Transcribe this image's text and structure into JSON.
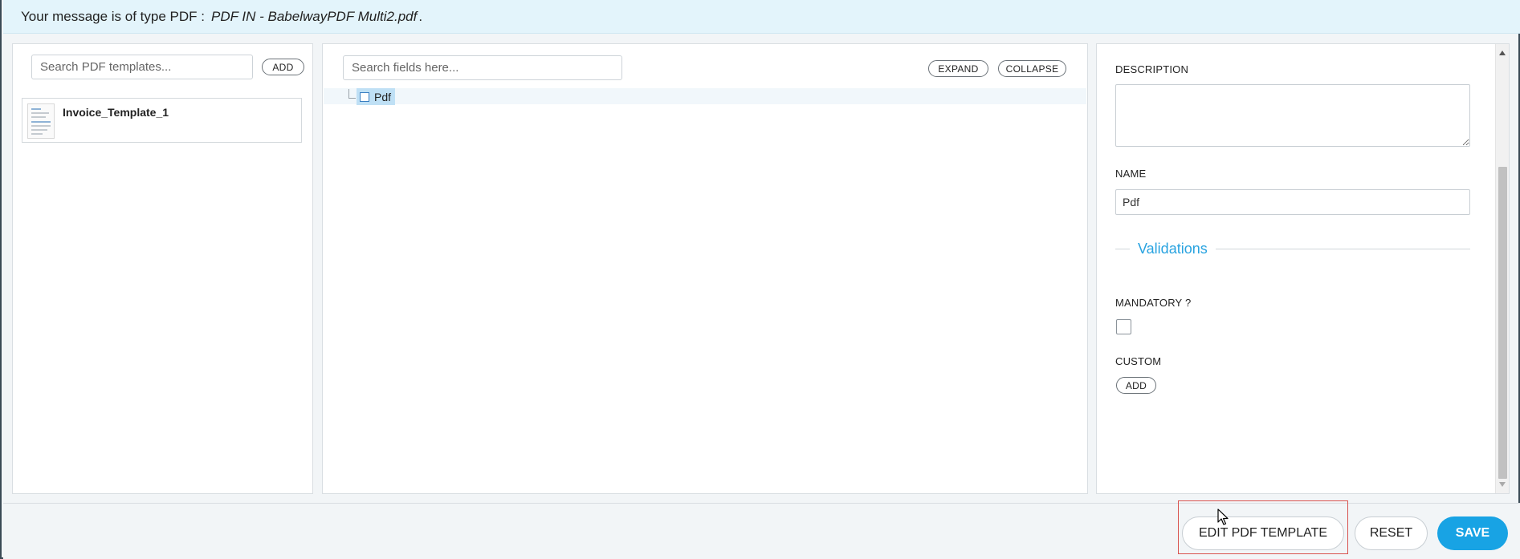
{
  "infobar": {
    "message_prefix": "Your message is of type PDF :",
    "message_file": "PDF IN - BabelwayPDF Multi2.pdf",
    "message_suffix": "."
  },
  "left_panel": {
    "search_placeholder": "Search PDF templates...",
    "add_label": "ADD",
    "templates": [
      {
        "name": "Invoice_Template_1"
      }
    ]
  },
  "middle_panel": {
    "search_placeholder": "Search fields here...",
    "expand_label": "EXPAND",
    "collapse_label": "COLLAPSE",
    "tree": [
      {
        "label": "Pdf",
        "selected": true
      }
    ]
  },
  "right_panel": {
    "description_label": "DESCRIPTION",
    "description_value": "",
    "name_label": "NAME",
    "name_value": "Pdf",
    "validations_title": "Validations",
    "mandatory_label": "MANDATORY ?",
    "mandatory_checked": false,
    "custom_label": "CUSTOM",
    "custom_add_label": "ADD"
  },
  "footer": {
    "edit_label": "EDIT PDF TEMPLATE",
    "reset_label": "RESET",
    "save_label": "SAVE"
  },
  "colors": {
    "accent": "#18a3e4",
    "info_bg": "#e3f4fb",
    "highlight": "#d9534f"
  }
}
